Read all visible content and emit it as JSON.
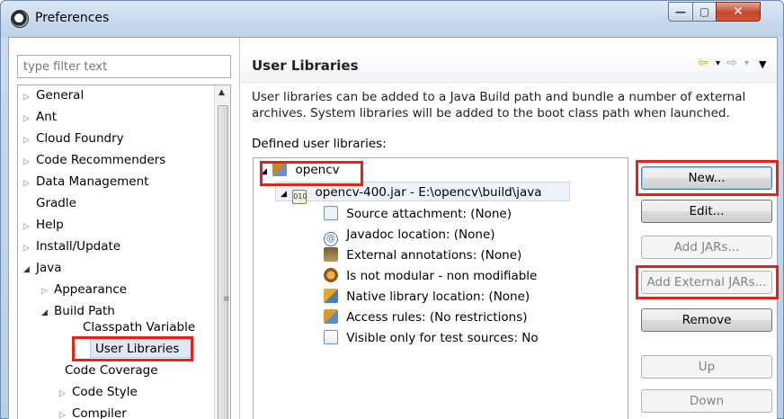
{
  "window": {
    "title": "Preferences",
    "minimize_label": "—",
    "maximize_label": "▢",
    "close_label": "✕"
  },
  "filter": {
    "placeholder": "type filter text"
  },
  "nav": {
    "items": [
      {
        "label": "General",
        "expander": "▷"
      },
      {
        "label": "Ant",
        "expander": "▷"
      },
      {
        "label": "Cloud Foundry",
        "expander": "▷"
      },
      {
        "label": "Code Recommenders",
        "expander": "▷"
      },
      {
        "label": "Data Management",
        "expander": "▷"
      },
      {
        "label": "Gradle",
        "expander": ""
      },
      {
        "label": "Help",
        "expander": "▷"
      },
      {
        "label": "Install/Update",
        "expander": "▷"
      },
      {
        "label": "Java",
        "expander": "◢"
      },
      {
        "label": "Appearance",
        "expander": "▷"
      },
      {
        "label": "Build Path",
        "expander": "◢"
      },
      {
        "label": "Classpath Variable",
        "expander": ""
      },
      {
        "label": "User Libraries",
        "expander": ""
      },
      {
        "label": "Code Coverage",
        "expander": ""
      },
      {
        "label": "Code Style",
        "expander": "▷"
      },
      {
        "label": "Compiler",
        "expander": "▷"
      }
    ]
  },
  "page": {
    "title": "User Libraries",
    "back_icon": "⇦",
    "forward_icon": "⇨",
    "menu_icon": "▼",
    "dropdown_icon": "▾",
    "description": "User libraries can be added to a Java Build path and bundle a number of external archives. System libraries will be added to the boot class path when launched.",
    "defined_label": "Defined user libraries:"
  },
  "libraries": {
    "library_name": "opencv",
    "jar_name": "opencv-400.jar - E:\\opencv\\build\\java",
    "attributes": [
      {
        "label": "Source attachment: (None)",
        "icon": "source-attachment-icon"
      },
      {
        "label": "Javadoc location: (None)",
        "icon": "javadoc-icon"
      },
      {
        "label": "External annotations: (None)",
        "icon": "annotations-icon"
      },
      {
        "label": "Is not modular - non modifiable",
        "icon": "module-icon"
      },
      {
        "label": "Native library location: (None)",
        "icon": "native-library-icon"
      },
      {
        "label": "Access rules: (No restrictions)",
        "icon": "access-rules-icon"
      },
      {
        "label": "Visible only for test sources: No",
        "icon": "test-sources-icon"
      }
    ]
  },
  "buttons": {
    "new": "New...",
    "edit": "Edit...",
    "add_jars": "Add JARs...",
    "add_external_jars": "Add External JARs...",
    "remove": "Remove",
    "up": "Up",
    "down": "Down"
  },
  "colors": {
    "highlight": "#e2231a",
    "selection": "#dde8f5"
  }
}
